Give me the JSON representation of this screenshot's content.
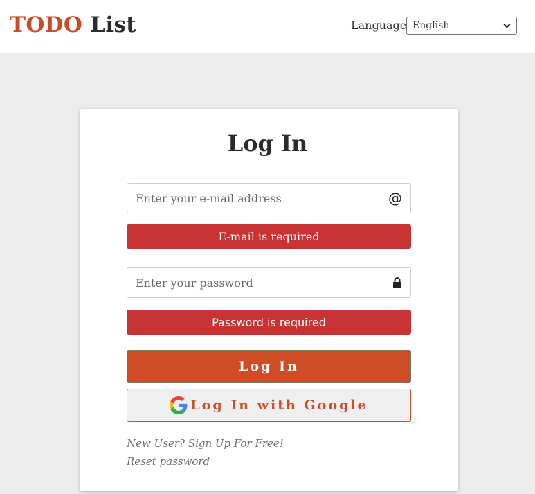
{
  "header": {
    "brand_todo": "TODO",
    "brand_list": "List",
    "language_label": "Language",
    "language_selected": "English"
  },
  "login": {
    "title": "Log In",
    "email_placeholder": "Enter your e-mail address",
    "email_error": "E-mail is required",
    "password_placeholder": "Enter your password",
    "password_error": "Password is required",
    "login_button": "Log In",
    "google_button": "Log In with Google",
    "signup_link": "New User? Sign Up For Free!",
    "reset_link": "Reset password"
  },
  "icons": {
    "email": "at-icon",
    "password": "lock-icon",
    "google": "google-icon",
    "select": "chevron-down-icon"
  },
  "colors": {
    "accent": "#cd4d26",
    "error": "#c83333",
    "background": "#ececec"
  }
}
